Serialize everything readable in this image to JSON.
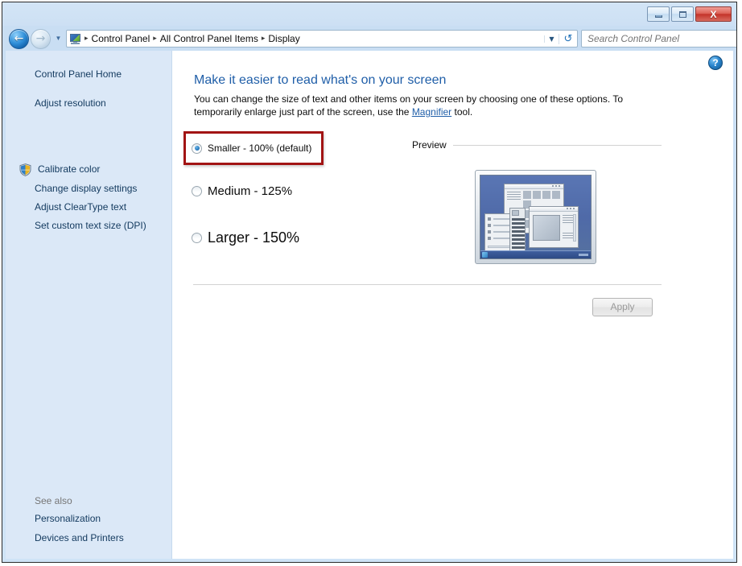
{
  "window": {
    "minimize_label": "Minimize",
    "maximize_label": "Maximize",
    "close_label": "X"
  },
  "nav": {
    "back_glyph": "←",
    "forward_glyph": "→",
    "history_glyph": "▼",
    "address_dropdown_glyph": "▼",
    "refresh_glyph": "↺"
  },
  "address": {
    "crumbs": [
      {
        "label": "Control Panel"
      },
      {
        "label": "All Control Panel Items"
      },
      {
        "label": "Display"
      }
    ],
    "separator": "▸"
  },
  "search": {
    "placeholder": "Search Control Panel",
    "value": "",
    "icon_glyph": "⚲"
  },
  "sidebar": {
    "home_label": "Control Panel Home",
    "items": [
      {
        "label": "Adjust resolution",
        "shield": false
      },
      {
        "label": "Calibrate color",
        "shield": true
      },
      {
        "label": "Change display settings",
        "shield": false
      },
      {
        "label": "Adjust ClearType text",
        "shield": false
      },
      {
        "label": "Set custom text size (DPI)",
        "shield": false
      }
    ],
    "see_also_label": "See also",
    "see_also_items": [
      {
        "label": "Personalization"
      },
      {
        "label": "Devices and Printers"
      }
    ]
  },
  "content": {
    "help_glyph": "?",
    "heading": "Make it easier to read what's on your screen",
    "description_before": "You can change the size of text and other items on your screen by choosing one of these options. To temporarily enlarge just part of the screen, use the ",
    "description_link": "Magnifier",
    "description_after": " tool.",
    "options": [
      {
        "label": "Smaller - 100% (default)",
        "checked": true,
        "font_size": "12px",
        "highlighted": true
      },
      {
        "label": "Medium - 125%",
        "checked": false,
        "font_size": "15px",
        "highlighted": false
      },
      {
        "label": "Larger - 150%",
        "checked": false,
        "font_size": "18px",
        "highlighted": false
      }
    ],
    "preview_label": "Preview",
    "apply_label": "Apply",
    "apply_enabled": false
  },
  "colors": {
    "accent_blue": "#1f5ea8",
    "highlight_red": "#a21414",
    "sidebar_bg": "#dbe8f7",
    "link_blue": "#1f5ea8",
    "disabled_text": "#9a9a9a",
    "desktop_blue": "#4f6aa8"
  }
}
